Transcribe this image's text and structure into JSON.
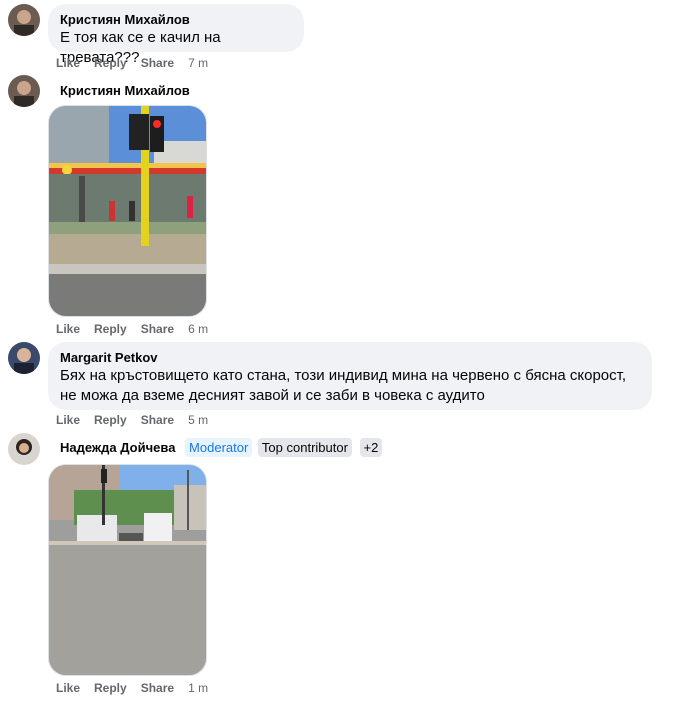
{
  "comments": [
    {
      "author": "Кристиян Михайлов",
      "text": "Е тоя как се е качил на тревата???",
      "actions": {
        "like": "Like",
        "reply": "Reply",
        "share": "Share",
        "time": "7 m"
      }
    },
    {
      "author": "Кристиян Михайлов",
      "actions": {
        "like": "Like",
        "reply": "Reply",
        "share": "Share",
        "time": "6 m"
      }
    },
    {
      "author": "Margarit Petkov",
      "text_line1": "Бях на кръстовището като стана, този индивид мина на червено с бясна скорост,",
      "text_line2": "не можа да вземе десният завой и се заби в човека с аудито",
      "actions": {
        "like": "Like",
        "reply": "Reply",
        "share": "Share",
        "time": "5 m"
      }
    },
    {
      "author": "Надежда Дойчева",
      "badges": {
        "moderator": "Moderator",
        "top": "Top contributor",
        "more": "+2"
      },
      "actions": {
        "like": "Like",
        "reply": "Reply",
        "share": "Share",
        "time": "1 m"
      }
    }
  ],
  "colors": {
    "bubble": "#f0f2f5",
    "action_text": "#65676b",
    "moderator_badge_bg": "#e7f3ff",
    "moderator_badge_text": "#1877f2"
  }
}
